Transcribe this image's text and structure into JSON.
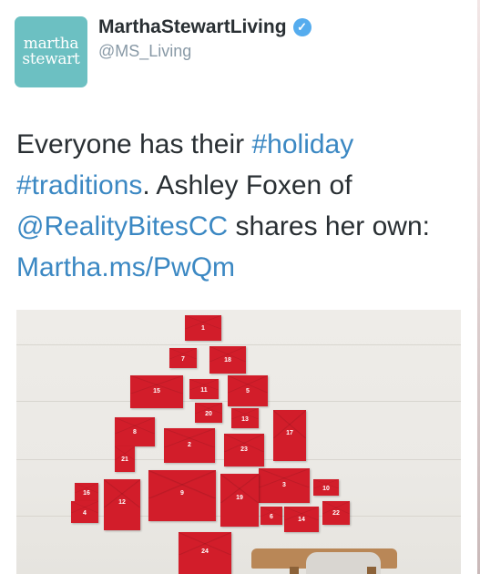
{
  "account": {
    "avatar_line1": "martha",
    "avatar_line2": "stewart",
    "display_name": "MarthaStewartLiving",
    "verified_icon": "verified-badge-icon",
    "handle": "@MS_Living"
  },
  "tweet": {
    "t1": "Everyone has their ",
    "h1": "#holiday",
    "h2": "#traditions",
    "t2": ". Ashley Foxen of",
    "mention": "@RealityBitesCC",
    "t3": " shares her own:",
    "url": "Martha.ms/PwQm"
  },
  "colors": {
    "link": "#3b88c3",
    "avatar_bg": "#6cc0c2",
    "envelope": "#d21d2a"
  },
  "photo": {
    "envelope_numbers": [
      "1",
      "7",
      "18",
      "15",
      "11",
      "5",
      "20",
      "13",
      "8",
      "21",
      "2",
      "23",
      "17",
      "9",
      "3",
      "10",
      "16",
      "12",
      "19",
      "6",
      "14",
      "22",
      "4",
      "24"
    ]
  }
}
